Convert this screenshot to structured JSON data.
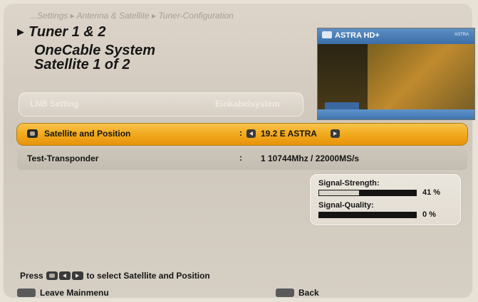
{
  "breadcrumb": "...Settings ▸ Antenna & Satellite ▸ Tuner-Configuration",
  "title": "Tuner 1 & 2",
  "subtitle_line1": "OneCable System",
  "subtitle_line2": "Satellite 1 of 2",
  "preview": {
    "channel": "ASTRA HD+",
    "top_right_text": "ASTRA"
  },
  "lnb_setting": {
    "label": "LNB Setting",
    "value": "Einkabelsystem"
  },
  "rows": [
    {
      "label": "Satellite and Position",
      "colon": ":",
      "value": "19.2 E ASTRA",
      "selected": true
    },
    {
      "label": "Test-Transponder",
      "colon": ":",
      "value": "1   10744Mhz / 22000MS/s",
      "selected": false
    }
  ],
  "signal": {
    "strength_label": "Signal-Strength:",
    "strength_value": "41 %",
    "strength_percent": 41,
    "quality_label": "Signal-Quality:",
    "quality_value": "0 %",
    "quality_percent": 0
  },
  "hint": {
    "prefix": "Press",
    "suffix": "to select Satellite and Position"
  },
  "footer": {
    "menu_label": "Leave Mainmenu",
    "back_label": "Back"
  },
  "colors": {
    "selected_row": "#f1a81b",
    "background": "#d6cfc4"
  }
}
